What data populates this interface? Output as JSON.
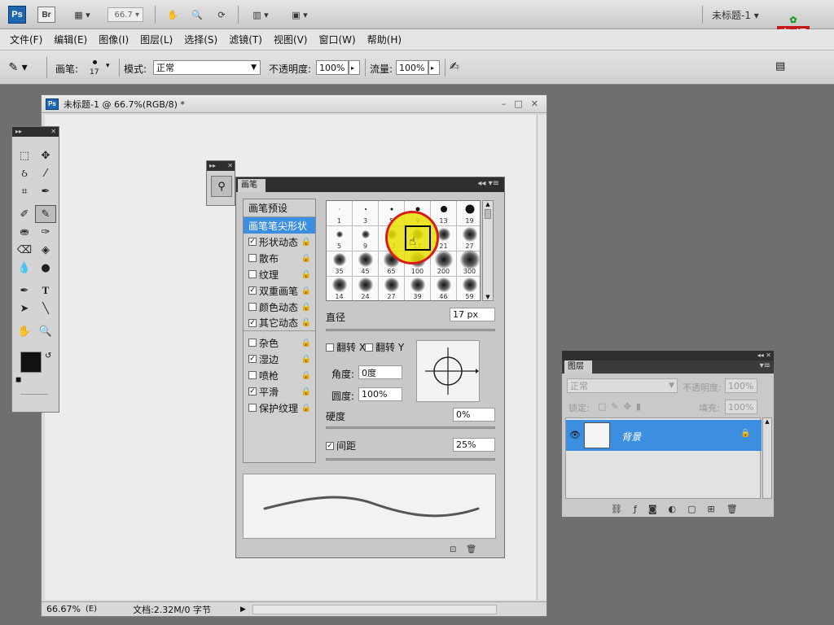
{
  "appbar": {
    "ps": "Ps",
    "br": "Br",
    "zoom": "66.7",
    "doc_name": "未标题-1"
  },
  "menu": [
    "文件(F)",
    "编辑(E)",
    "图像(I)",
    "图层(L)",
    "选择(S)",
    "滤镜(T)",
    "视图(V)",
    "窗口(W)",
    "帮助(H)"
  ],
  "options": {
    "brush_label": "画笔:",
    "brush_size": "17",
    "mode_label": "模式:",
    "mode_value": "正常",
    "opacity_label": "不透明度:",
    "opacity_value": "100%",
    "flow_label": "流量:",
    "flow_value": "100%"
  },
  "logo": {
    "top": "育",
    "mid": "课",
    "l1": "教",
    "l2": "育"
  },
  "document": {
    "title": "未标题-1 @ 66.7%(RGB/8) *",
    "zoom": "66.67%",
    "status": "文档:2.32M/0 字节"
  },
  "brush_panel": {
    "tab": "画笔",
    "preset": "画笔预设",
    "items": [
      {
        "label": "画笔笔尖形状",
        "check": false,
        "selected": true,
        "lock": false
      },
      {
        "label": "形状动态",
        "check": true,
        "lock": true
      },
      {
        "label": "散布",
        "check": false,
        "lock": true
      },
      {
        "label": "纹理",
        "check": false,
        "lock": true
      },
      {
        "label": "双重画笔",
        "check": true,
        "lock": true
      },
      {
        "label": "颜色动态",
        "check": false,
        "lock": true
      },
      {
        "label": "其它动态",
        "check": true,
        "lock": true
      },
      {
        "label": "杂色",
        "check": false,
        "lock": true
      },
      {
        "label": "湿边",
        "check": true,
        "lock": true
      },
      {
        "label": "喷枪",
        "check": false,
        "lock": true
      },
      {
        "label": "平滑",
        "check": true,
        "lock": true
      },
      {
        "label": "保护纹理",
        "check": false,
        "lock": true
      }
    ],
    "tips": [
      "1",
      "3",
      "5",
      "9",
      "13",
      "19",
      "5",
      "9",
      "13",
      "17",
      "21",
      "27",
      "35",
      "45",
      "65",
      "100",
      "200",
      "300",
      "14",
      "24",
      "27",
      "39",
      "46",
      "59"
    ],
    "diameter_label": "直径",
    "diameter_value": "17 px",
    "flip_x": "翻转 X",
    "flip_y": "翻转 Y",
    "angle_label": "角度:",
    "angle_value": "0度",
    "roundness_label": "圆度:",
    "roundness_value": "100%",
    "hardness_label": "硬度",
    "hardness_value": "0%",
    "spacing_label": "间距",
    "spacing_value": "25%"
  },
  "layers": {
    "tab": "图层",
    "mode": "正常",
    "opacity_label": "不透明度:",
    "opacity_value": "100%",
    "lock_label": "锁定:",
    "fill_label": "填充:",
    "fill_value": "100%",
    "layer_name": "背景"
  },
  "colors": {
    "accent": "#3c8ee0",
    "highlight": "#e6e000",
    "ring": "#d81c1c"
  }
}
